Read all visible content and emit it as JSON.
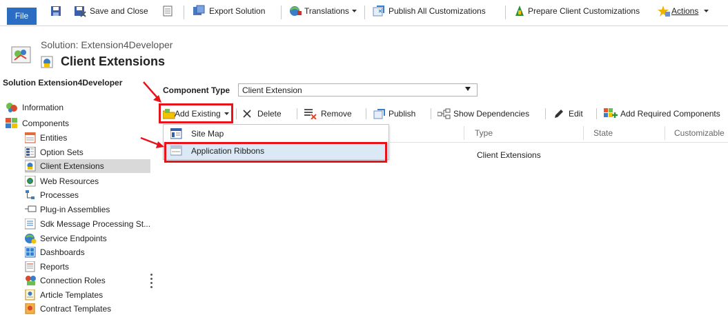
{
  "ribbon": {
    "file_label": "File",
    "save_and_close": "Save and Close",
    "export_solution": "Export Solution",
    "translations": "Translations",
    "publish_all": "Publish All Customizations",
    "prepare_client": "Prepare Client Customizations",
    "actions": "Actions"
  },
  "header": {
    "solution_name": "Solution: Extension4Developer",
    "page_title": "Client Extensions"
  },
  "nav": {
    "title": "Solution Extension4Developer",
    "items": [
      {
        "label": "Information",
        "icon": "information-icon"
      },
      {
        "label": "Components",
        "icon": "components-icon"
      },
      {
        "label": "Entities",
        "icon": "entities-icon"
      },
      {
        "label": "Option Sets",
        "icon": "option-sets-icon"
      },
      {
        "label": "Client Extensions",
        "icon": "client-extensions-icon",
        "selected": true
      },
      {
        "label": "Web Resources",
        "icon": "web-resources-icon"
      },
      {
        "label": "Processes",
        "icon": "processes-icon"
      },
      {
        "label": "Plug-in Assemblies",
        "icon": "plugin-assemblies-icon"
      },
      {
        "label": "Sdk Message Processing St...",
        "icon": "sdk-message-icon"
      },
      {
        "label": "Service Endpoints",
        "icon": "service-endpoints-icon"
      },
      {
        "label": "Dashboards",
        "icon": "dashboards-icon"
      },
      {
        "label": "Reports",
        "icon": "reports-icon"
      },
      {
        "label": "Connection Roles",
        "icon": "connection-roles-icon"
      },
      {
        "label": "Article Templates",
        "icon": "article-templates-icon"
      },
      {
        "label": "Contract Templates",
        "icon": "contract-templates-icon"
      }
    ]
  },
  "component_type": {
    "label": "Component Type",
    "selected": "Client Extension"
  },
  "toolbar": {
    "add_existing": "Add Existing",
    "delete": "Delete",
    "remove": "Remove",
    "publish": "Publish",
    "show_dependencies": "Show Dependencies",
    "edit": "Edit",
    "add_required": "Add Required Components"
  },
  "grid": {
    "columns": [
      "Type",
      "State",
      "Customizable"
    ],
    "rows": [
      {
        "type": "Client Extensions"
      }
    ]
  },
  "dropdown": {
    "items": [
      {
        "label": "Site Map",
        "icon": "site-map-icon"
      },
      {
        "label": "Application Ribbons",
        "icon": "application-ribbons-icon"
      }
    ]
  },
  "colors": {
    "file_tab": "#2a6dc2",
    "highlight": "#e8121b",
    "selected_nav": "#d9d9d9",
    "dropdown_hover": "#dbe9f6"
  }
}
